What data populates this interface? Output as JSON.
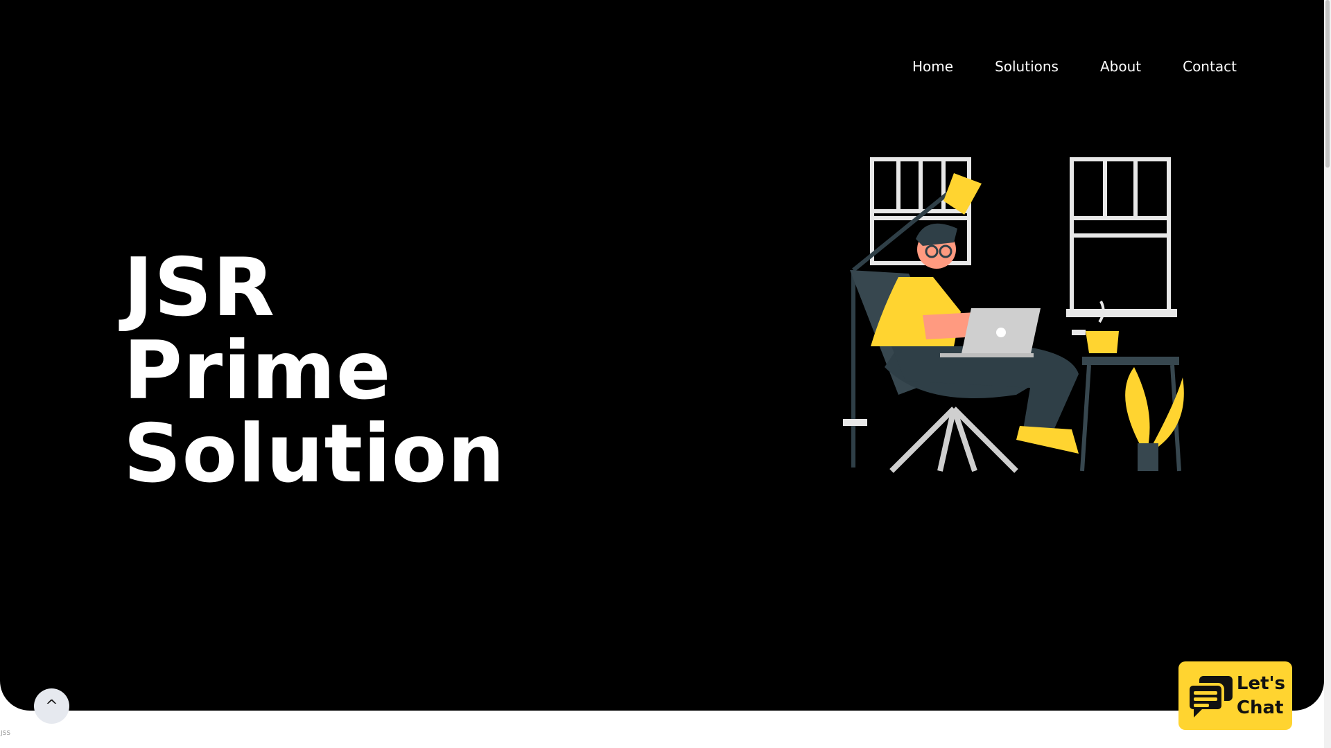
{
  "nav": {
    "items": [
      {
        "label": "Home"
      },
      {
        "label": "Solutions"
      },
      {
        "label": "About"
      },
      {
        "label": "Contact"
      }
    ]
  },
  "hero": {
    "title_lines": [
      "JSR",
      "Prime",
      "Solution"
    ],
    "illustration": "person-working-on-laptop-illustration"
  },
  "controls": {
    "scroll_top_label": "^",
    "chat_label": "Let's\nChat",
    "chat_icon": "chat-bubbles-icon"
  },
  "footer": {
    "tiny_text": "JSS"
  },
  "colors": {
    "background": "#000000",
    "accent": "#ffd430",
    "text": "#ffffff"
  }
}
